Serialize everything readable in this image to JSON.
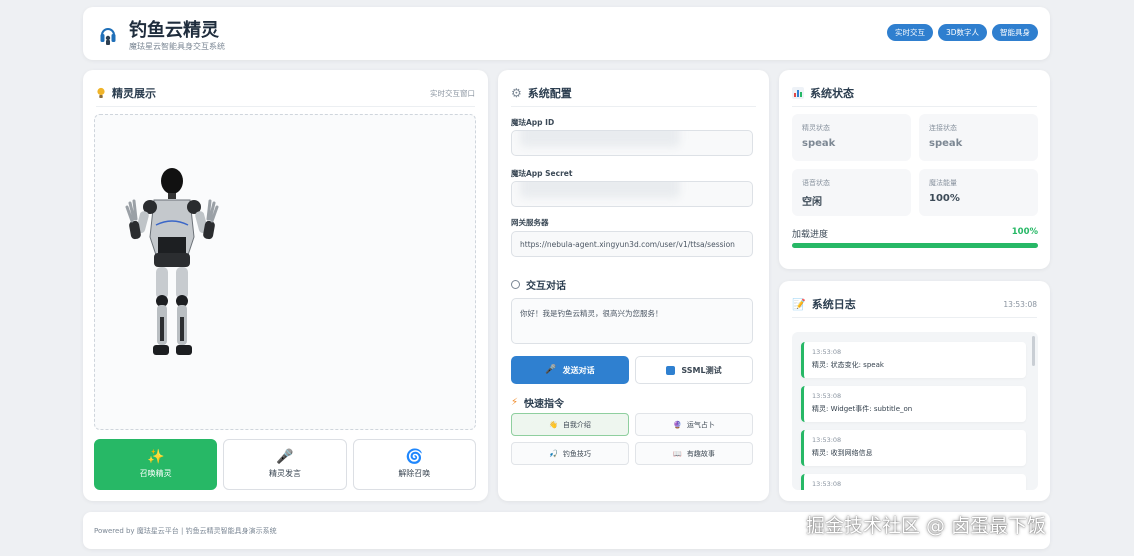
{
  "header": {
    "title": "钓鱼云精灵",
    "subtitle": "魔珐星云智能具身交互系统",
    "badges": [
      "实时交互",
      "3D数字人",
      "智能具身"
    ]
  },
  "sprite_panel": {
    "title": "精灵展示",
    "hint": "实时交互窗口",
    "actions": [
      {
        "label": "召唤精灵",
        "icon": "sparkles-icon"
      },
      {
        "label": "精灵发言",
        "icon": "microphone-icon"
      },
      {
        "label": "解除召唤",
        "icon": "swirl-icon"
      }
    ]
  },
  "config_panel": {
    "title": "系统配置",
    "app_id_label": "魔珐App ID",
    "app_id_value": "",
    "app_secret_label": "魔珐App Secret",
    "app_secret_value": "",
    "gateway_label": "网关服务器",
    "gateway_value": "https://nebula-agent.xingyun3d.com/user/v1/ttsa/session",
    "chat_title": "交互对话",
    "chat_text": "你好！我是钓鱼云精灵，很高兴为您服务！",
    "send_label": "发送对话",
    "ssml_label": "SSML测试",
    "quick_title": "快速指令",
    "quick": [
      {
        "label": "自我介绍",
        "icon": "wave-hand-icon"
      },
      {
        "label": "运气占卜",
        "icon": "crystal-ball-icon"
      },
      {
        "label": "钓鱼技巧",
        "icon": "fishing-hook-icon"
      },
      {
        "label": "有趣故事",
        "icon": "book-icon"
      }
    ]
  },
  "status_panel": {
    "title": "系统状态",
    "cells": [
      {
        "label": "精灵状态",
        "value": "speak"
      },
      {
        "label": "连接状态",
        "value": "speak"
      },
      {
        "label": "语音状态",
        "value": "空闲"
      },
      {
        "label": "魔法能量",
        "value": "100%"
      }
    ],
    "progress_label": "加载进度",
    "progress_text": "100%",
    "progress": 1.0
  },
  "log_panel": {
    "title": "系统日志",
    "time": "13:53:08",
    "entries": [
      {
        "time": "13:53:08",
        "msg": "精灵: 状态变化: speak"
      },
      {
        "time": "13:53:08",
        "msg": "精灵: Widget事件: subtitle_on"
      },
      {
        "time": "13:53:08",
        "msg": "精灵: 收到网络信息"
      },
      {
        "time": "13:53:08",
        "msg": ""
      }
    ]
  },
  "footer": {
    "text": "Powered by 魔珐星云平台 | 钓鱼云精灵智能具身演示系统"
  },
  "watermark": "掘金技术社区 @ 卤蛋最下饭",
  "colors": {
    "primary_blue": "#2f80d0",
    "success_green": "#27b866",
    "background": "#eef0f3"
  }
}
